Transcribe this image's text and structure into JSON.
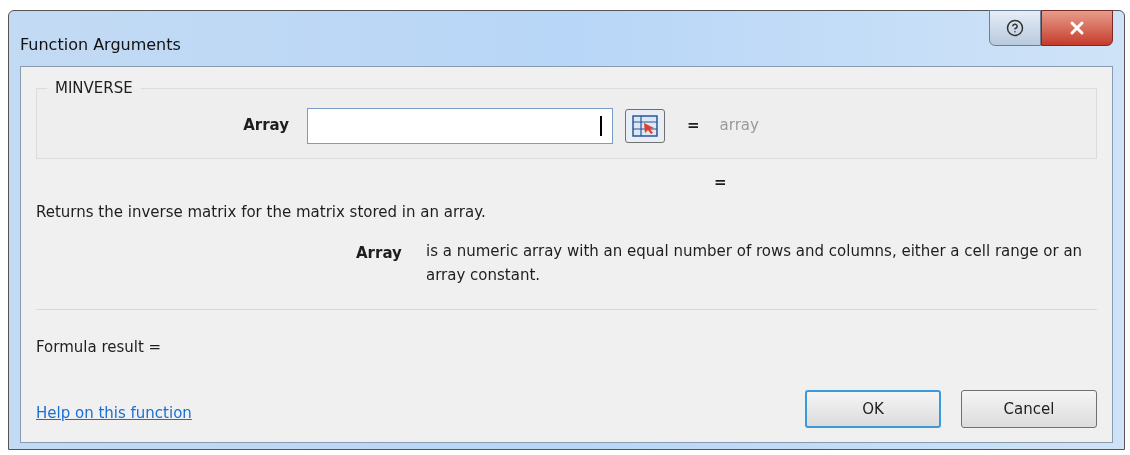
{
  "window": {
    "title": "Function Arguments"
  },
  "function": {
    "name": "MINVERSE",
    "arguments": [
      {
        "label": "Array",
        "focused": true,
        "equals": "=",
        "evaluation": "array"
      }
    ]
  },
  "result_equals": "=",
  "description": "Returns the inverse matrix for the matrix stored in an array.",
  "argument_help": {
    "name": "Array",
    "text": "is a numeric array with an equal number of rows and columns, either a cell range or an array constant."
  },
  "formula_result": "Formula result =",
  "help_link": "Help on this function",
  "buttons": [
    {
      "label": "OK",
      "default": true
    },
    {
      "label": "Cancel",
      "default": false
    }
  ]
}
